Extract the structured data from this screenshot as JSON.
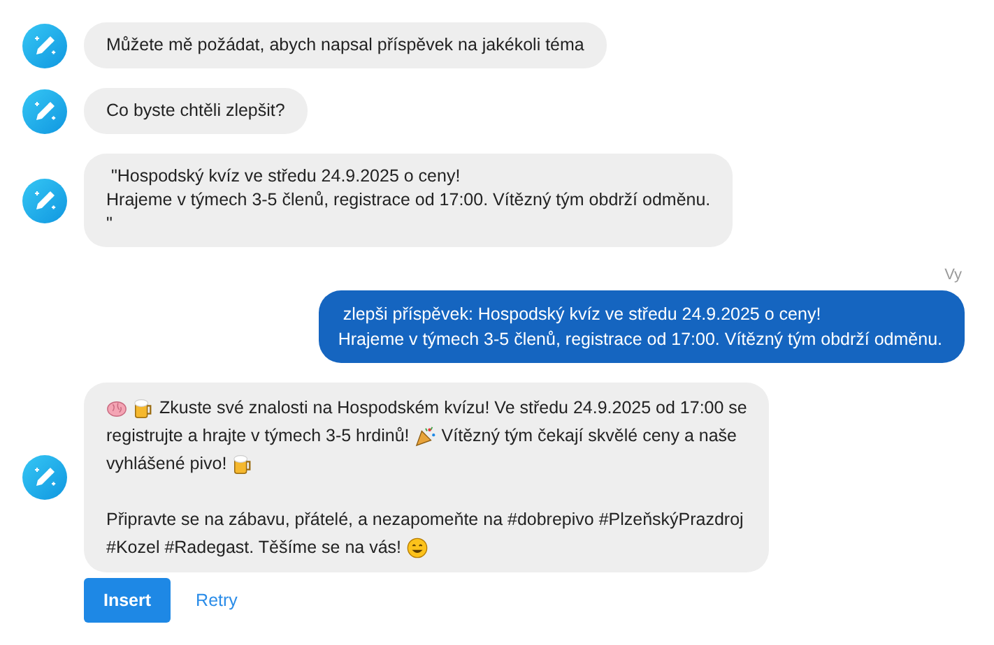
{
  "messages": [
    {
      "kind": "bot",
      "paragraphs": [
        [
          [
            {
              "kind": "text",
              "text": "Můžete mě požádat, abych napsal příspěvek na jakékoli téma"
            }
          ]
        ]
      ]
    },
    {
      "kind": "bot",
      "paragraphs": [
        [
          [
            {
              "kind": "text",
              "text": "Co byste chtěli zlepšit?"
            }
          ]
        ]
      ]
    },
    {
      "kind": "bot",
      "paragraphs": [
        [
          [
            {
              "kind": "text",
              "text": " \"Hospodský kvíz ve středu 24.9.2025 o ceny!\nHrajeme v týmech 3-5 členů, registrace od 17:00. Vítězný tým obdrží odměnu.\n\""
            }
          ]
        ]
      ]
    },
    {
      "kind": "user",
      "label": "Vy",
      "paragraphs": [
        [
          [
            {
              "kind": "text",
              "text": " zlepši příspěvek: Hospodský kvíz ve středu 24.9.2025 o ceny!\nHrajeme v týmech 3-5 členů, registrace od 17:00. Vítězný tým obdrží odměnu."
            }
          ]
        ]
      ]
    },
    {
      "kind": "bot",
      "paragraphs": [
        [
          [
            {
              "kind": "brain"
            },
            {
              "kind": "beer"
            },
            {
              "kind": "text",
              "text": "Zkuste své znalosti na Hospodském kvízu! Ve středu 24.9.2025 od 17:00 se"
            }
          ],
          [
            {
              "kind": "text",
              "text": "registrujte a hrajte v týmech 3-5 hrdinů!"
            },
            {
              "kind": "party"
            },
            {
              "kind": "text",
              "text": "Vítězný tým čekají skvělé ceny a naše"
            }
          ],
          [
            {
              "kind": "text",
              "text": "vyhlášené pivo!"
            },
            {
              "kind": "beer"
            }
          ]
        ],
        [
          [
            {
              "kind": "text",
              "text": "Připravte se na zábavu, přátelé, a nezapomeňte na #dobrepivo #PlzeňskýPrazdroj"
            }
          ],
          [
            {
              "kind": "text",
              "text": "#Kozel #Radegast. Těšíme se na vás!"
            },
            {
              "kind": "smile"
            }
          ]
        ]
      ]
    }
  ],
  "actions": [
    {
      "kind": "primary",
      "label": "Insert"
    },
    {
      "kind": "link",
      "label": "Retry"
    }
  ]
}
